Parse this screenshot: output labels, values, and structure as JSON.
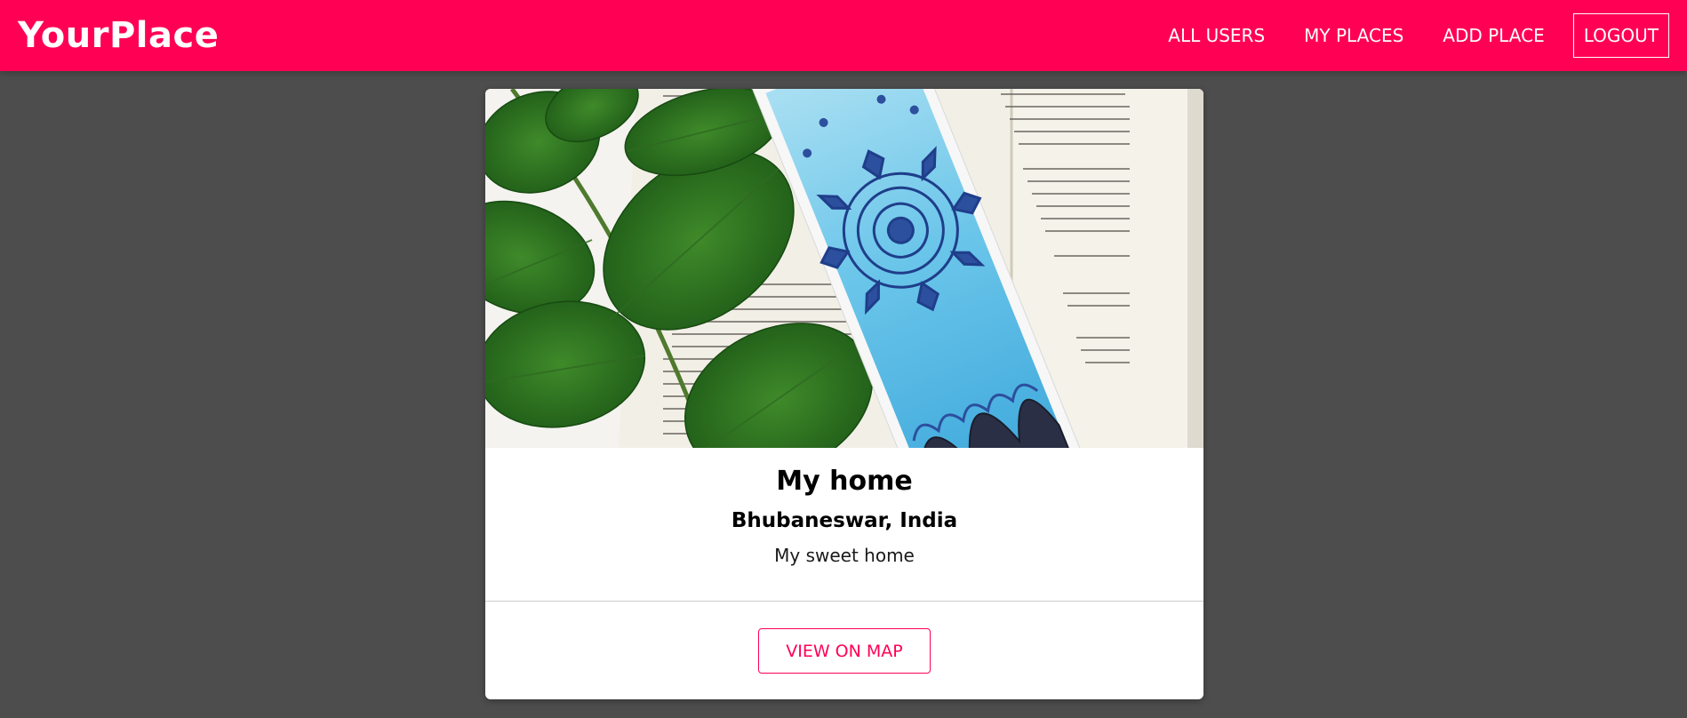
{
  "header": {
    "brand": "YourPlace",
    "nav": {
      "all_users": "ALL USERS",
      "my_places": "MY PLACES",
      "add_place": "ADD PLACE",
      "logout": "LOGOUT"
    }
  },
  "place": {
    "title": "My home",
    "address": "Bhubaneswar, India",
    "description": "My sweet home",
    "image_alt": "My home",
    "view_on_map": "VIEW ON MAP"
  },
  "colors": {
    "brand": "#ff0055",
    "background": "#4d4d4d",
    "card": "#ffffff"
  }
}
